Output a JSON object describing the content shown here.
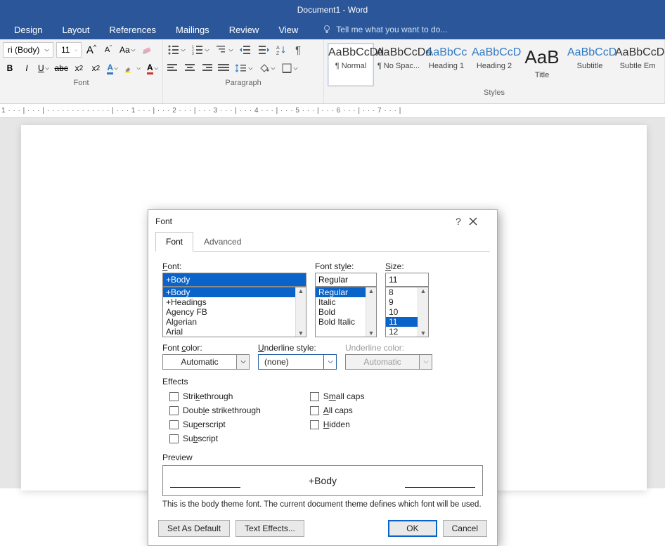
{
  "title": "Document1 - Word",
  "ribbonTabs": [
    "Design",
    "Layout",
    "References",
    "Mailings",
    "Review",
    "View"
  ],
  "tellMe": "Tell me what you want to do...",
  "fontGroup": {
    "label": "Font",
    "fontName": "ri (Body)",
    "fontSize": "11",
    "buttons": {
      "growA": "A",
      "shrinkA": "A",
      "changeCase": "Aa",
      "bold": "B",
      "italic": "I",
      "underline": "U",
      "strike": "abc",
      "sub": "x",
      "sup": "x"
    }
  },
  "paraGroup": {
    "label": "Paragraph"
  },
  "stylesGroup": {
    "label": "Styles",
    "items": [
      {
        "sample": "AaBbCcDd",
        "caption": "¶ Normal",
        "sel": true,
        "cls": ""
      },
      {
        "sample": "AaBbCcDd",
        "caption": "¶ No Spac...",
        "cls": ""
      },
      {
        "sample": "AaBbCc",
        "caption": "Heading 1",
        "cls": "h"
      },
      {
        "sample": "AaBbCcD",
        "caption": "Heading 2",
        "cls": "h"
      },
      {
        "sample": "AaB",
        "caption": "Title",
        "cls": "t"
      },
      {
        "sample": "AaBbCcD",
        "caption": "Subtitle",
        "cls": "h"
      },
      {
        "sample": "AaBbCcDd",
        "caption": "Subtle Em",
        "cls": ""
      }
    ]
  },
  "ruler": "1 · · · | · · · | · · · · · · · · · · · · · | · · · 1 · · · | · · · 2 · · · | · · · 3 · · · | · · · 4 · · · | · · · 5 · · · | · · · 6 · · · | · · · 7 · · · |",
  "dialog": {
    "title": "Font",
    "help": "?",
    "tabs": {
      "font": "Font",
      "advanced": "Advanced"
    },
    "font": {
      "label": "Font:",
      "labelU": "F",
      "value": "+Body",
      "items": [
        "+Body",
        "+Headings",
        "Agency FB",
        "Algerian",
        "Arial"
      ],
      "selIdx": 0
    },
    "style": {
      "label": "Font style:",
      "labelU": "y",
      "value": "Regular",
      "items": [
        "Regular",
        "Italic",
        "Bold",
        "Bold Italic"
      ],
      "selIdx": 0
    },
    "size": {
      "label": "Size:",
      "labelU": "S",
      "value": "11",
      "items": [
        "8",
        "9",
        "10",
        "11",
        "12"
      ],
      "selIdx": 3
    },
    "fontColor": {
      "label": "Font color:",
      "labelU": "c",
      "value": "Automatic"
    },
    "underlineStyle": {
      "label": "Underline style:",
      "labelU": "U",
      "value": "(none)"
    },
    "underlineColor": {
      "label": "Underline color:",
      "value": "Automatic"
    },
    "effectsLabel": "Effects",
    "effectsLeft": [
      {
        "t": "Strikethrough",
        "u": "k"
      },
      {
        "t": "Double strikethrough",
        "u": "l"
      },
      {
        "t": "Superscript",
        "u": "p"
      },
      {
        "t": "Subscript",
        "u": "b"
      }
    ],
    "effectsRight": [
      {
        "t": "Small caps",
        "u": "m"
      },
      {
        "t": "All caps",
        "u": "A"
      },
      {
        "t": "Hidden",
        "u": "H"
      }
    ],
    "previewLabel": "Preview",
    "previewText": "+Body",
    "previewDesc": "This is the body theme font. The current document theme defines which font will be used.",
    "buttons": {
      "setDefault": "Set As Default",
      "textEffects": "Text Effects...",
      "ok": "OK",
      "cancel": "Cancel"
    }
  }
}
